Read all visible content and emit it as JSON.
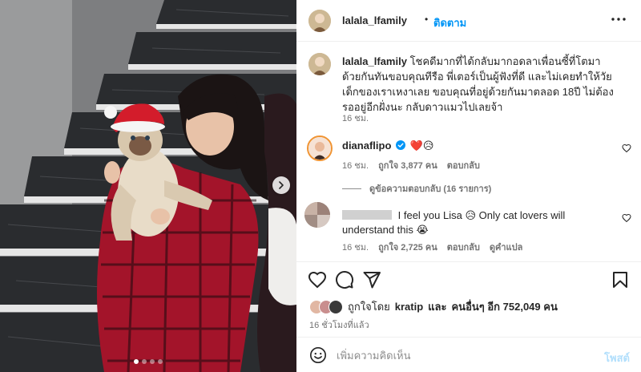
{
  "post": {
    "username": "lalala_lfamily",
    "separator": "•",
    "follow_label": "ติดตาม",
    "caption_text": "โชคดีมากที่ได้กลับมากอดลาเพื่อนซี้ที่โตมาด้วยกันทันขอบคุณทีรือ พี่เตอร์เป็นผู้ฟังที่ดี และไม่เคยทำให้วัยเด็กของเราเหงาเลย ขอบคุณที่อยู่ด้วยกันมาตลอด 18ปี ไม่ต้องรออยู่อีกฝั่งนะ กลับดาวแมวไปเลยจ้า",
    "caption_time": "16 ชม."
  },
  "comments": [
    {
      "username": "dianaflipo",
      "verified": true,
      "text": "❤️😥",
      "time": "16 ชม.",
      "likes": "ถูกใจ 3,877 คน",
      "reply_label": "ตอบกลับ",
      "view_replies": "ดูข้อความตอบกลับ (16 รายการ)"
    },
    {
      "text": "I feel you Lisa 😥 Only cat lovers will understand this 😭",
      "time": "16 ชม.",
      "likes": "ถูกใจ 2,725 คน",
      "reply_label": "ตอบกลับ",
      "translate_label": "ดูคำแปล"
    }
  ],
  "actions": {
    "icons": [
      "heart-icon",
      "comment-icon",
      "share-icon",
      "bookmark-icon"
    ]
  },
  "likes_summary": {
    "prefix": "ถูกใจโดย",
    "user": "kratip",
    "middle": "และ",
    "others": "คนอื่นๆ อีก 752,049 คน"
  },
  "posted_time": "16 ชั่วโมงที่แล้ว",
  "comment_box": {
    "placeholder": "เพิ่มความคิดเห็น",
    "post_label": "โพสต์"
  },
  "colors": {
    "accent": "#0095f6",
    "post_disabled": "#b2dffc",
    "verified": "#0095f6"
  }
}
